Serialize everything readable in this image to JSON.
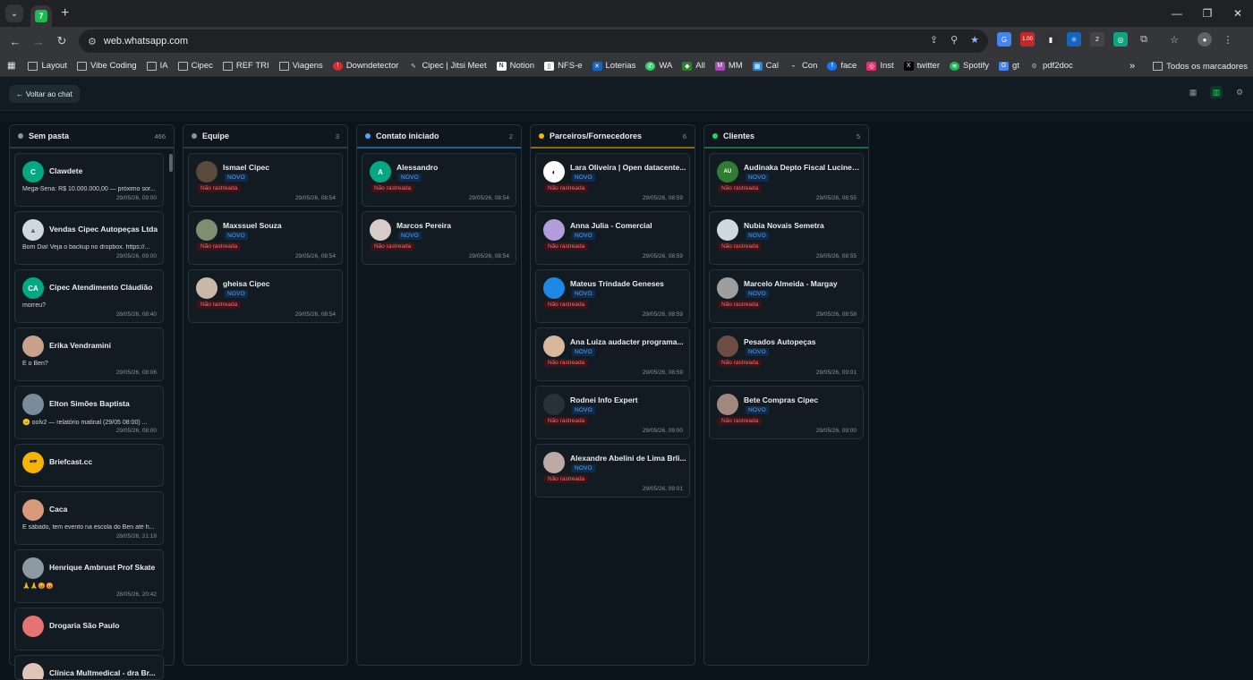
{
  "browser": {
    "url": "web.whatsapp.com",
    "tab_icon": "7",
    "bookmarks": [
      "Layout",
      "Vibe Coding",
      "IA",
      "Cipec",
      "REF TRI",
      "Viagens",
      "Downdetector",
      "Cipec | Jitsi Meet",
      "Notion",
      "NFS-e",
      "Loterias",
      "WA",
      "All",
      "MM",
      "Cal",
      "Con",
      "face",
      "Inst",
      "twitter",
      "Spotify",
      "gt",
      "pdf2doc"
    ],
    "bookmarks_overflow": "»",
    "bookmarks_all": "Todos os marcadores",
    "ext_badges": [
      "1.00",
      "2"
    ]
  },
  "header": {
    "back_label": "← Voltar ao chat"
  },
  "columns": [
    {
      "title": "Sem pasta",
      "count": "466",
      "color": "#8696a0",
      "cards": [
        {
          "name": "Clawdete",
          "avatar_text": "C",
          "avatar_color": "#00a884",
          "msg": "Mega-Sena: R$ 10.000.000,00 — próximo sor...",
          "time": "29/05/26, 09:00"
        },
        {
          "name": "Vendas Cipec Autopeças Ltda",
          "avatar_text": "",
          "avatar_color": "#cfd8dc",
          "msg": "Bom Dia! Veja o backup no dropbox. https://...",
          "time": "29/05/26, 09:00"
        },
        {
          "name": "Cipec Atendimento Cláudião",
          "avatar_text": "CA",
          "avatar_color": "#00a884",
          "msg": "morreu?",
          "time": "28/05/26, 08:40"
        },
        {
          "name": "Erika Vendramini",
          "avatar_text": "",
          "avatar_color": "#c9a28c",
          "msg": "E o Ben?",
          "time": "29/05/26, 08:06"
        },
        {
          "name": "Elton Simões Baptista",
          "avatar_text": "",
          "avatar_color": "#7a8c99",
          "msg": "😐 oolv2 — relatório matinal (29/05 08:00) ...",
          "time": "29/05/26, 08:00"
        },
        {
          "name": "Briefcast.cc",
          "avatar_text": "❝❞",
          "avatar_color": "#f5b400",
          "msg": "",
          "time": ""
        },
        {
          "name": "Caca",
          "avatar_text": "",
          "avatar_color": "#d99a7a",
          "msg": "E sábado, tem evento na escola do Ben até h...",
          "time": "28/05/26, 21:18"
        },
        {
          "name": "Henrique Ambrust Prof Skate",
          "avatar_text": "",
          "avatar_color": "#8d9aa3",
          "msg": "🙏🙏😡😡",
          "time": "28/05/26, 20:42"
        },
        {
          "name": "Drogaria São Paulo",
          "avatar_text": "",
          "avatar_color": "#e57373",
          "msg": "",
          "time": ""
        },
        {
          "name": "Clínica Multmedical - dra Br...",
          "avatar_text": "",
          "avatar_color": "#e0c4b8",
          "msg": "",
          "time": ""
        }
      ]
    },
    {
      "title": "Equipe",
      "count": "3",
      "color": "#8696a0",
      "cards": [
        {
          "name": "Ismael Cipec",
          "avatar_text": "",
          "avatar_color": "#5a4a3a",
          "badge": "NOVO",
          "tag": "Não rastreada",
          "time": "29/05/26, 08:54"
        },
        {
          "name": "Maxssuel Souza",
          "avatar_text": "",
          "avatar_color": "#7d8f6e",
          "badge": "NOVO",
          "tag": "Não rastreada",
          "time": "29/05/26, 08:54"
        },
        {
          "name": "gheisa Cipec",
          "avatar_text": "",
          "avatar_color": "#c9b8a8",
          "badge": "NOVO",
          "tag": "Não rastreada",
          "time": "29/05/26, 08:54"
        }
      ]
    },
    {
      "title": "Contato iniciado",
      "count": "2",
      "color": "#53a6ff",
      "cards": [
        {
          "name": "Alessandro",
          "avatar_text": "A",
          "avatar_color": "#00a884",
          "badge": "NOVO",
          "tag": "Não rastreada",
          "time": "29/05/26, 08:54"
        },
        {
          "name": "Marcos Pereira",
          "avatar_text": "",
          "avatar_color": "#d7ccc8",
          "badge": "NOVO",
          "tag": "Não rastreada",
          "time": "29/05/26, 08:54"
        }
      ]
    },
    {
      "title": "Parceiros/Fornecedores",
      "count": "6",
      "color": "#f5b400",
      "cards": [
        {
          "name": "Lara Oliveira | Open datacente...",
          "avatar_text": "◐",
          "avatar_color": "#ffffff",
          "badge": "NOVO",
          "tag": "Não rastreada",
          "time": "29/05/26, 08:59"
        },
        {
          "name": "Anna Julia - Comercial",
          "avatar_text": "",
          "avatar_color": "#b39ddb",
          "badge": "NOVO",
          "tag": "Não rastreada",
          "time": "29/05/26, 08:59"
        },
        {
          "name": "Mateus Trindade Geneses",
          "avatar_text": "",
          "avatar_color": "#1e88e5",
          "badge": "NOVO",
          "tag": "Não rastreada",
          "time": "29/05/26, 08:59"
        },
        {
          "name": "Ana Luiza audacter programa...",
          "avatar_text": "",
          "avatar_color": "#d7b89c",
          "badge": "NOVO",
          "tag": "Não rastreada",
          "time": "29/05/26, 08:59"
        },
        {
          "name": "Rodnei Info Expert",
          "avatar_text": "",
          "avatar_color": "#263238",
          "badge": "NOVO",
          "tag": "Não rastreada",
          "time": "29/05/26, 09:00"
        },
        {
          "name": "Alexandre Abelini de Lima Brli...",
          "avatar_text": "",
          "avatar_color": "#bcaaa4",
          "badge": "NOVO",
          "tag": "Não rastreada",
          "time": "29/05/26, 09:01"
        }
      ]
    },
    {
      "title": "Clientes",
      "count": "5",
      "color": "#25d366",
      "cards": [
        {
          "name": "Audinaka Depto Fiscal Lucinei...",
          "avatar_text": "AU",
          "avatar_color": "#2e7d32",
          "badge": "NOVO",
          "tag": "Não rastreada",
          "time": "29/05/26, 08:55"
        },
        {
          "name": "Nubia Novais Semetra",
          "avatar_text": "",
          "avatar_color": "#cfd8dc",
          "badge": "NOVO",
          "tag": "Não rastreada",
          "time": "29/05/26, 08:55"
        },
        {
          "name": "Marcelo Almeida - Margay",
          "avatar_text": "",
          "avatar_color": "#9e9e9e",
          "badge": "NOVO",
          "tag": "Não rastreada",
          "time": "29/05/26, 08:58"
        },
        {
          "name": "Pesados Autopeças",
          "avatar_text": "",
          "avatar_color": "#6d4c41",
          "badge": "NOVO",
          "tag": "Não rastreada",
          "time": "29/05/26, 09:01"
        },
        {
          "name": "Bete Compras Cipec",
          "avatar_text": "",
          "avatar_color": "#a1887f",
          "badge": "NOVO",
          "tag": "Não rastreada",
          "time": "29/05/26, 09:00"
        }
      ]
    }
  ]
}
